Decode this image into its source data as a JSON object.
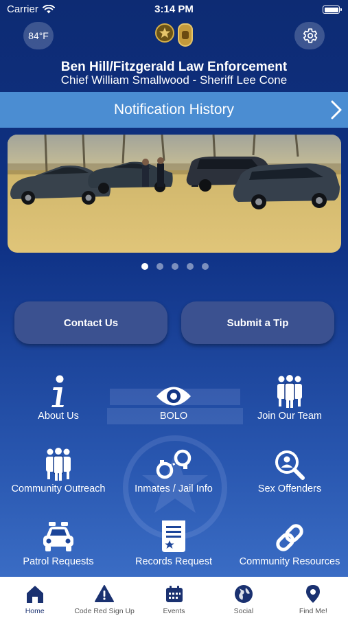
{
  "status_bar": {
    "carrier": "Carrier",
    "time": "3:14 PM"
  },
  "header": {
    "temperature": "84°F",
    "title": "Ben Hill/Fitzgerald Law Enforcement",
    "subtitle": "Chief William Smallwood - Sheriff Lee Cone"
  },
  "notification": {
    "label": "Notification History"
  },
  "carousel": {
    "slide_count": 5,
    "active_index": 0
  },
  "actions": {
    "contact": "Contact Us",
    "tip": "Submit a Tip"
  },
  "grid": [
    {
      "label": "About Us",
      "icon": "info-icon"
    },
    {
      "label": "BOLO",
      "icon": "eye-icon"
    },
    {
      "label": "Join Our Team",
      "icon": "team-icon"
    },
    {
      "label": "Community Outreach",
      "icon": "group-icon"
    },
    {
      "label": "Inmates / Jail Info",
      "icon": "handcuffs-icon"
    },
    {
      "label": "Sex Offenders",
      "icon": "search-person-icon"
    },
    {
      "label": "Patrol Requests",
      "icon": "police-car-icon"
    },
    {
      "label": "Records Request",
      "icon": "document-icon"
    },
    {
      "label": "Community Resources",
      "icon": "link-icon"
    }
  ],
  "tabs": [
    {
      "label": "Home",
      "icon": "home-icon",
      "active": true
    },
    {
      "label": "Code Red Sign Up",
      "icon": "warning-icon",
      "active": false
    },
    {
      "label": "Events",
      "icon": "calendar-icon",
      "active": false
    },
    {
      "label": "Social",
      "icon": "globe-icon",
      "active": false
    },
    {
      "label": "Find Me!",
      "icon": "location-pin-icon",
      "active": false
    }
  ],
  "colors": {
    "nav_blue": "#1a3170",
    "notification_bar": "#4b8dd2",
    "button_fill": "#3b5190"
  }
}
